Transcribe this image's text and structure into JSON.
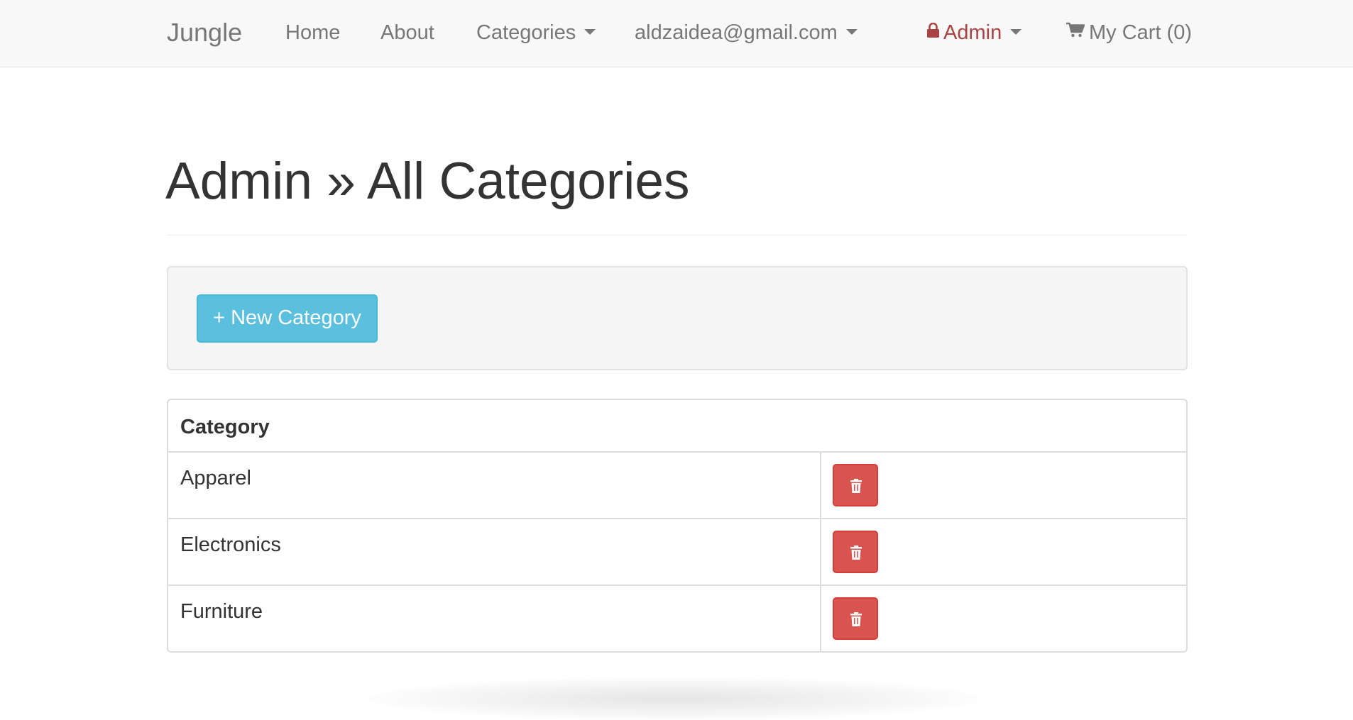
{
  "nav": {
    "brand": "Jungle",
    "home": "Home",
    "about": "About",
    "categories": "Categories",
    "user_email": "aldzaidea@gmail.com",
    "admin": "Admin",
    "cart": "My Cart (0)",
    "icons": {
      "admin": "lock-icon",
      "cart": "shopping-cart-icon"
    },
    "admin_color": "#a94442"
  },
  "page": {
    "title": "Admin » All Categories"
  },
  "toolbar": {
    "new_category_label": "+ New Category",
    "new_category_color": "#5bc0de"
  },
  "table": {
    "header": "Category",
    "rows": [
      {
        "name": "Apparel"
      },
      {
        "name": "Electronics"
      },
      {
        "name": "Furniture"
      }
    ],
    "delete_icon": "trash-icon",
    "delete_color": "#d9534f"
  }
}
